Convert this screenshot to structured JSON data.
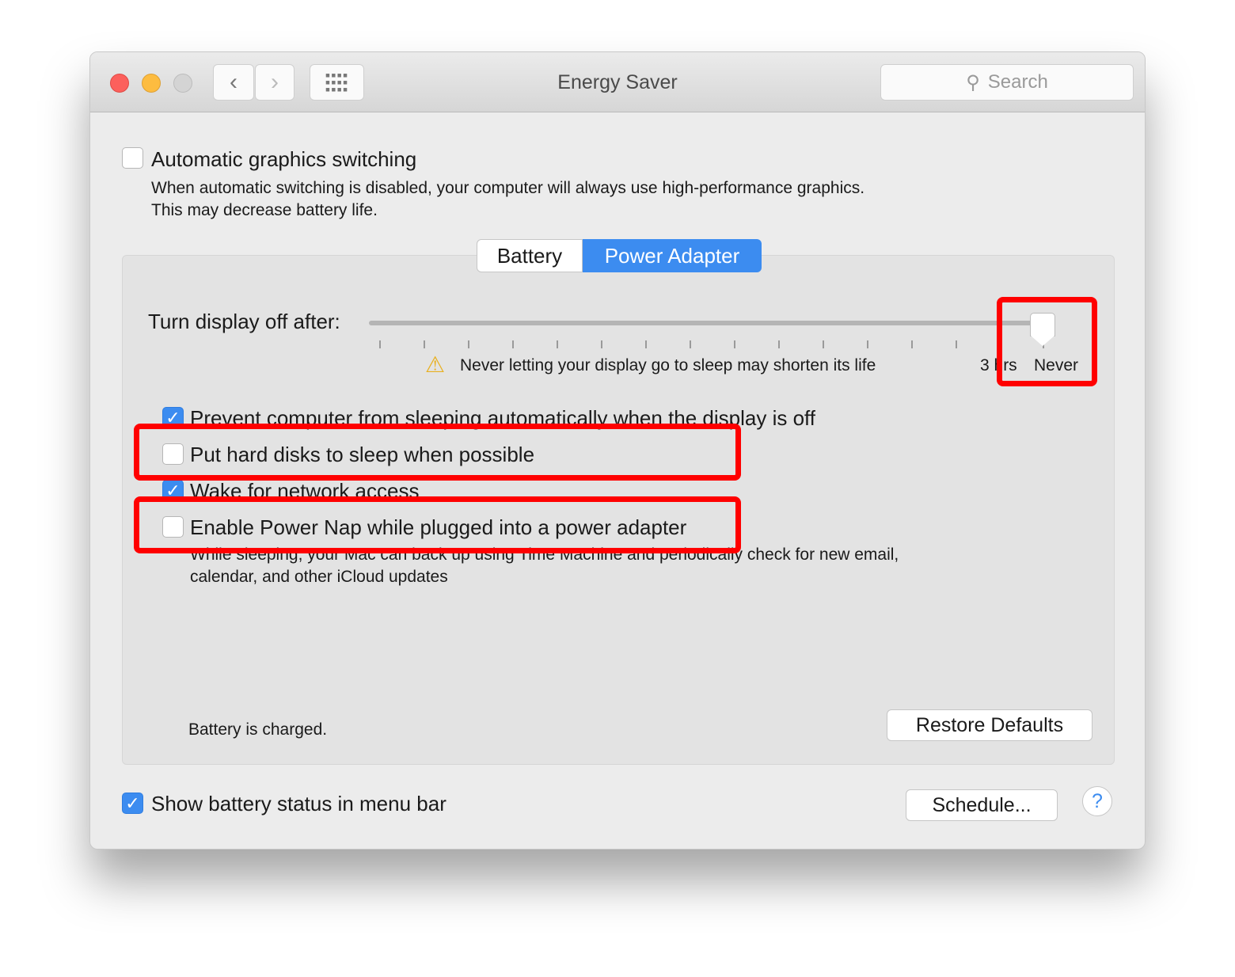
{
  "window": {
    "title": "Energy Saver",
    "search_placeholder": "Search"
  },
  "graphics": {
    "label": "Automatic graphics switching",
    "checked": false,
    "desc1": "When automatic switching is disabled, your computer will always use high-performance graphics.",
    "desc2": "This may decrease battery life."
  },
  "tabs": [
    {
      "label": "Battery",
      "selected": false
    },
    {
      "label": "Power Adapter",
      "selected": true
    }
  ],
  "slider": {
    "label": "Turn display off after:",
    "value": "Never",
    "warning": "Never letting your display go to sleep may shorten its life",
    "tick_labels": [
      "3 hrs",
      "Never"
    ]
  },
  "options": [
    {
      "label": "Prevent computer from sleeping automatically when the display is off",
      "checked": true
    },
    {
      "label": "Put hard disks to sleep when possible",
      "checked": false
    },
    {
      "label": "Wake for network access",
      "checked": true
    },
    {
      "label": "Enable Power Nap while plugged into a power adapter",
      "checked": false
    }
  ],
  "power_nap_desc1": "While sleeping, your Mac can back up using Time Machine and periodically check for new email,",
  "power_nap_desc2": "calendar, and other iCloud updates",
  "status": "Battery is charged.",
  "restore_defaults": "Restore Defaults",
  "show_battery": {
    "label": "Show battery status in menu bar",
    "checked": true
  },
  "schedule": "Schedule...",
  "help": "?",
  "colors": {
    "accent": "#3c8cf0",
    "highlight": "#ff0000"
  }
}
